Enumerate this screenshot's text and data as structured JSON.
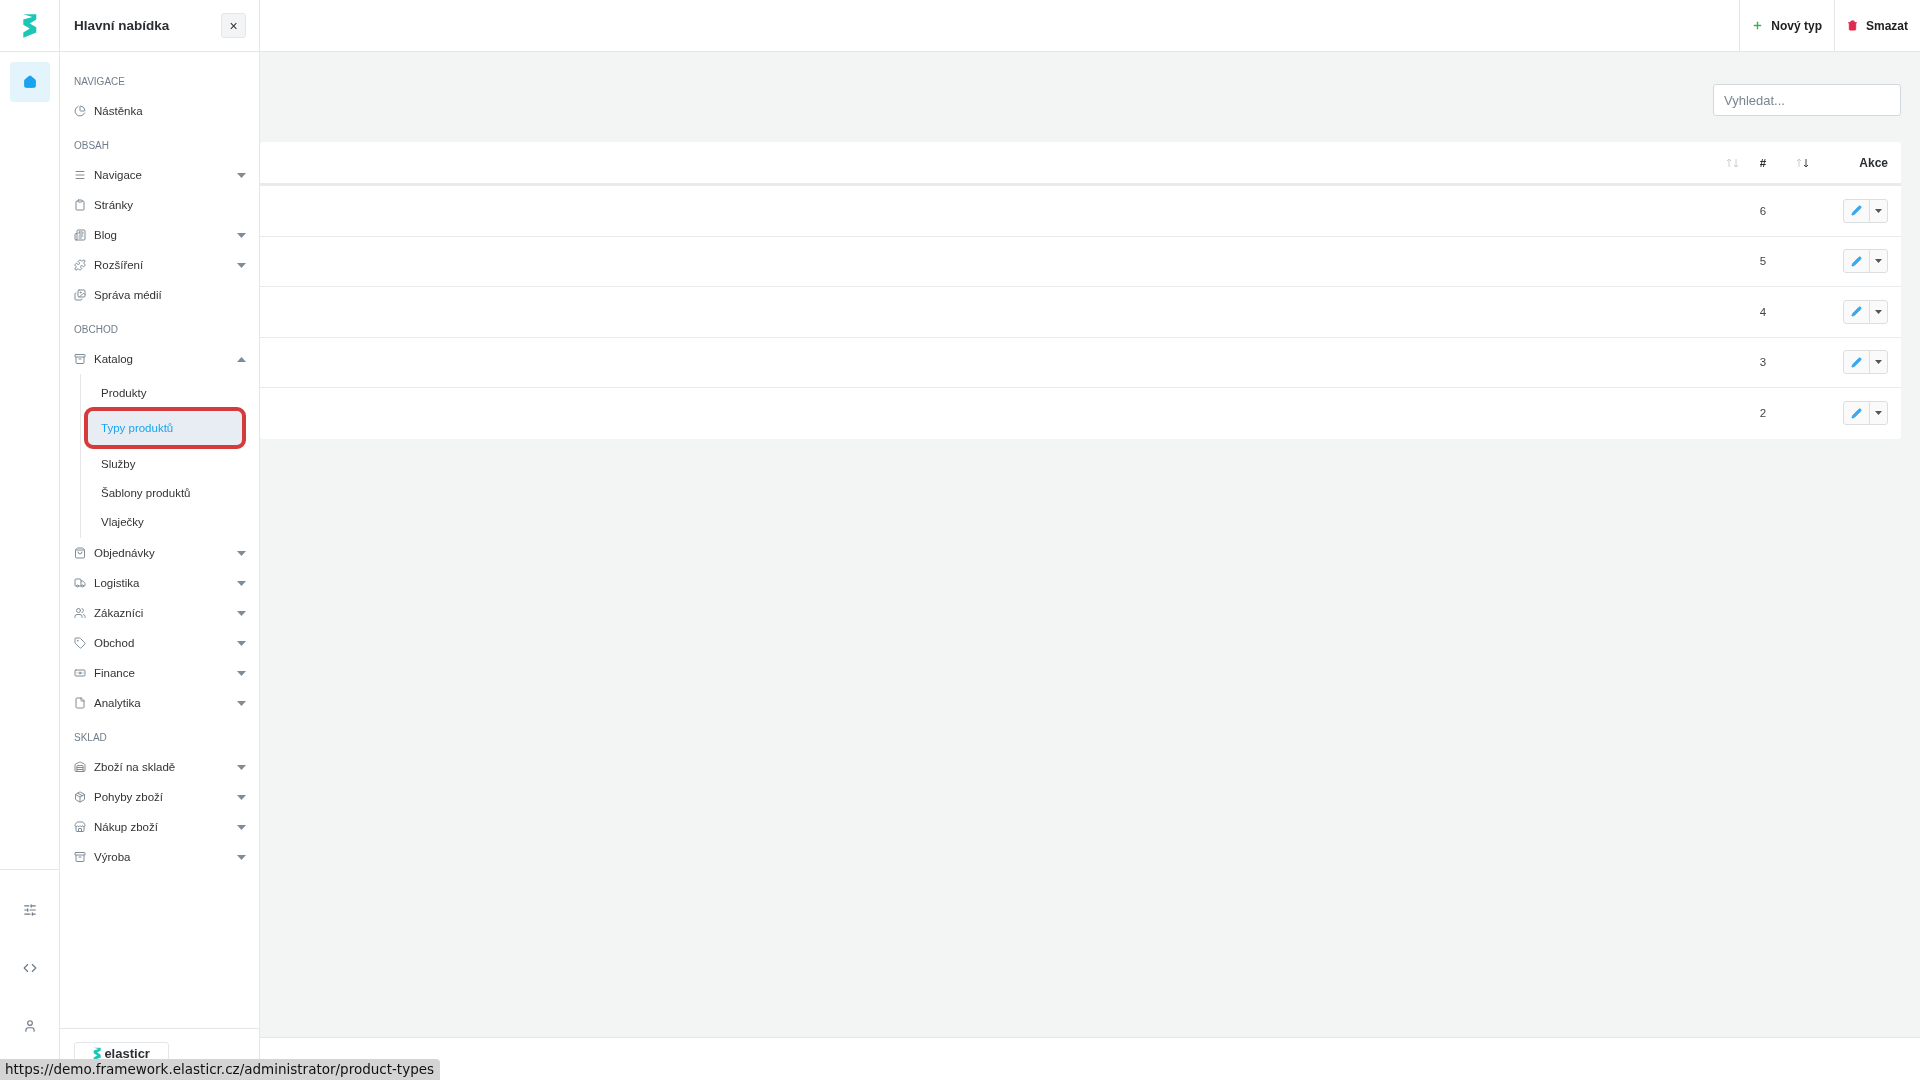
{
  "sidebar": {
    "title": "Hlavní nabídka",
    "close": "×",
    "sections": [
      {
        "heading": "NAVIGACE",
        "items": [
          {
            "label": "Nástěnka"
          }
        ]
      },
      {
        "heading": "OBSAH",
        "items": [
          {
            "label": "Navigace",
            "expanded": false
          },
          {
            "label": "Stránky"
          },
          {
            "label": "Blog",
            "expanded": false
          },
          {
            "label": "Rozšíření",
            "expanded": false
          },
          {
            "label": "Správa médií"
          }
        ]
      },
      {
        "heading": "OBCHOD",
        "items": [
          {
            "label": "Katalog",
            "expanded": true,
            "children": [
              {
                "label": "Produkty",
                "selected": false
              },
              {
                "label": "Typy produktů",
                "selected": true
              },
              {
                "label": "Služby",
                "selected": false
              },
              {
                "label": "Šablony produktů",
                "selected": false
              },
              {
                "label": "Vlaječky",
                "selected": false
              }
            ]
          },
          {
            "label": "Objednávky",
            "expanded": false
          },
          {
            "label": "Logistika",
            "expanded": false
          },
          {
            "label": "Zákazníci",
            "expanded": false
          },
          {
            "label": "Obchod",
            "expanded": false
          },
          {
            "label": "Finance",
            "expanded": false
          },
          {
            "label": "Analytika",
            "expanded": false
          }
        ]
      },
      {
        "heading": "SKLAD",
        "items": [
          {
            "label": "Zboží na skladě",
            "expanded": false
          },
          {
            "label": "Pohyby zboží",
            "expanded": false
          },
          {
            "label": "Nákup zboží",
            "expanded": false
          },
          {
            "label": "Výroba",
            "expanded": false
          }
        ]
      }
    ],
    "brand": "elasticr"
  },
  "rail": [
    {
      "selected": true
    },
    {
      "selected": false
    },
    {
      "selected": false
    },
    {
      "selected": false
    }
  ],
  "toolbar": [
    {
      "kind": "add",
      "label": "Nový typ"
    },
    {
      "kind": "delete",
      "label": "Smazat"
    }
  ],
  "search": {
    "placeholder": "Vyhledat..."
  },
  "table": {
    "columns": [
      {
        "sorted": false
      },
      {
        "label": "#",
        "sorted": true
      },
      {
        "label": "Akce"
      }
    ],
    "rows": [
      {
        "number": "6"
      },
      {
        "number": "5"
      },
      {
        "number": "4"
      },
      {
        "number": "3"
      },
      {
        "number": "2"
      }
    ]
  },
  "status_url": "https://demo.framework.elasticr.cz/administrator/product-types"
}
